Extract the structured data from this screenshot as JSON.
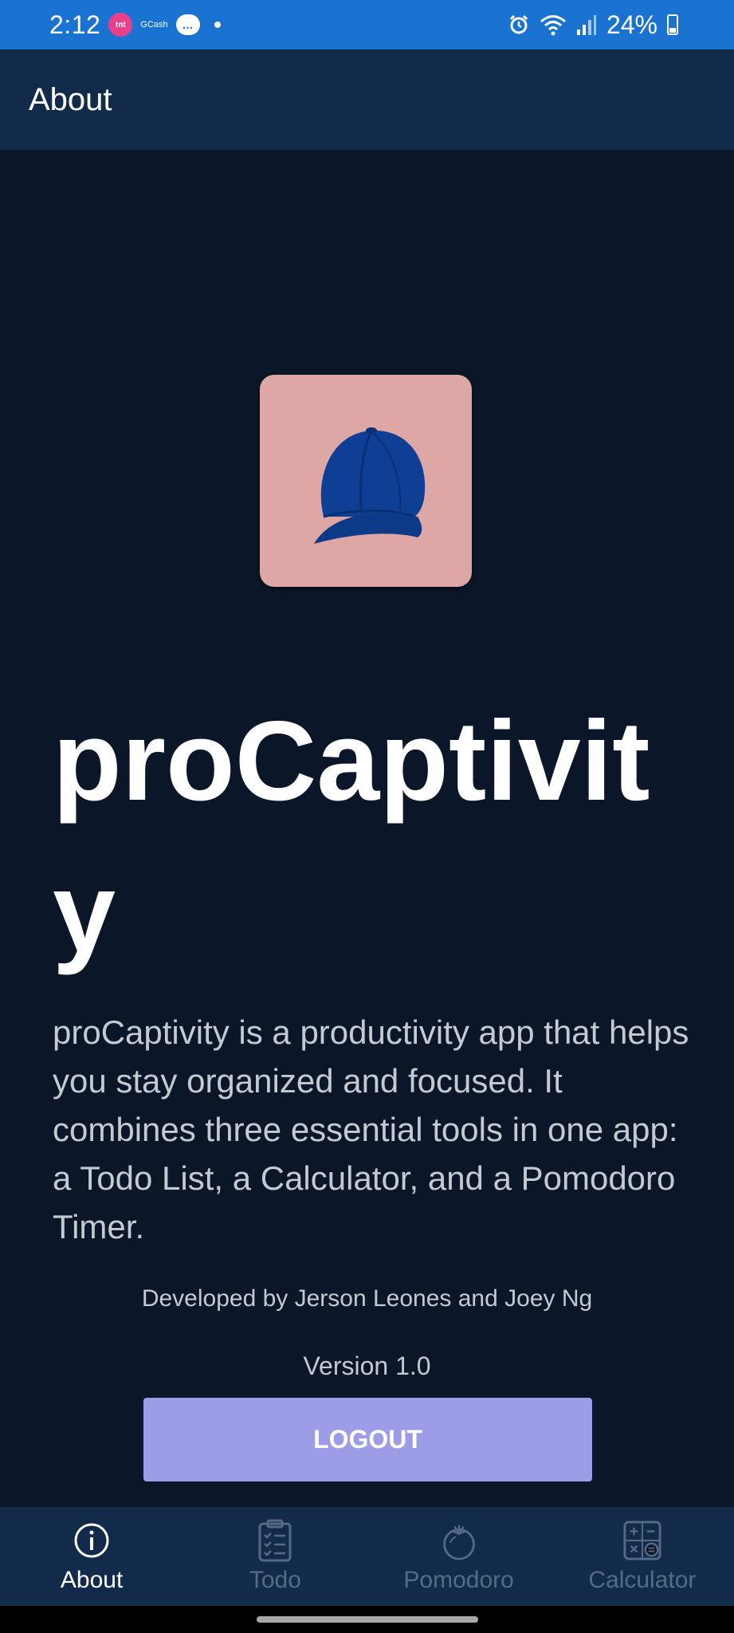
{
  "status_bar": {
    "time": "2:12",
    "tnt_badge": "tnt",
    "gcash": "GCash",
    "chat_icon": "…",
    "battery": "24%"
  },
  "app_bar": {
    "title": "About"
  },
  "logo": {
    "icon": "baseball-cap"
  },
  "app": {
    "name": "proCaptivity",
    "description": "proCaptivity is a productivity app that helps you stay organized and focused. It combines three essential tools in one app: a Todo List, a Calculator, and a Pomodoro Timer.",
    "developer": "Developed by Jerson Leones and Joey Ng",
    "version": "Version 1.0"
  },
  "logout_label": "LOGOUT",
  "nav": {
    "items": [
      {
        "label": "About",
        "icon": "info-icon",
        "active": true
      },
      {
        "label": "Todo",
        "icon": "clipboard-list-icon",
        "active": false
      },
      {
        "label": "Pomodoro",
        "icon": "tomato-icon",
        "active": false
      },
      {
        "label": "Calculator",
        "icon": "calculator-icon",
        "active": false
      }
    ]
  },
  "colors": {
    "status_bar": "#1a73d1",
    "app_bar": "#132b4a",
    "background": "#0b1628",
    "logo_bg": "#dca7a4",
    "button": "#9d9ce6",
    "nav_inactive": "#566a86"
  }
}
